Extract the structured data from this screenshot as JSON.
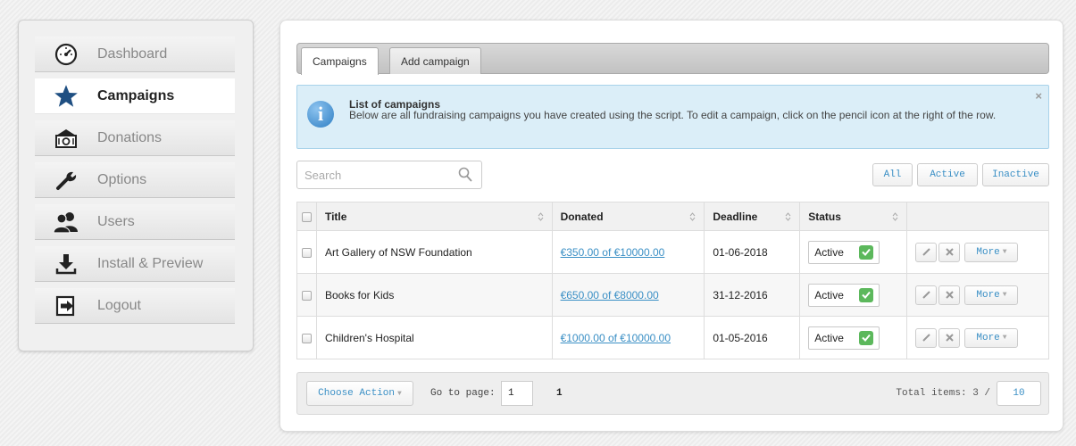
{
  "sidebar": {
    "items": [
      {
        "label": "Dashboard",
        "icon": "dashboard-icon"
      },
      {
        "label": "Campaigns",
        "icon": "star-icon",
        "active": true
      },
      {
        "label": "Donations",
        "icon": "money-icon"
      },
      {
        "label": "Options",
        "icon": "wrench-icon"
      },
      {
        "label": "Users",
        "icon": "users-icon"
      },
      {
        "label": "Install & Preview",
        "icon": "download-icon"
      },
      {
        "label": "Logout",
        "icon": "logout-icon"
      }
    ]
  },
  "tabs": [
    {
      "label": "Campaigns",
      "active": true
    },
    {
      "label": "Add campaign"
    }
  ],
  "info": {
    "title": "List of campaigns",
    "text": "Below are all fundraising campaigns you have created using the script. To edit a campaign, click on the pencil icon at the right of the row.",
    "close": "×"
  },
  "search": {
    "placeholder": "Search"
  },
  "filters": {
    "all": "All",
    "active": "Active",
    "inactive": "Inactive"
  },
  "table": {
    "headers": {
      "title": "Title",
      "donated": "Donated",
      "deadline": "Deadline",
      "status": "Status"
    },
    "rows": [
      {
        "title": "Art Gallery of NSW Foundation",
        "donated": "€350.00 of €10000.00",
        "deadline": "01-06-2018",
        "status": "Active"
      },
      {
        "title": "Books for Kids",
        "donated": "€650.00 of €8000.00",
        "deadline": "31-12-2016",
        "status": "Active"
      },
      {
        "title": "Children's Hospital",
        "donated": "€1000.00 of €10000.00",
        "deadline": "01-05-2016",
        "status": "Active"
      }
    ],
    "more_label": "More"
  },
  "footer": {
    "choose_action": "Choose Action",
    "goto_label": "Go to page:",
    "goto_value": "1",
    "page_count": "1",
    "total_label": "Total items: 3 /",
    "per_page": "10"
  },
  "colors": {
    "link": "#3a8fc5",
    "active_check": "#5cb85c",
    "info_bg": "#dbeef8",
    "star": "#1f4f82"
  }
}
